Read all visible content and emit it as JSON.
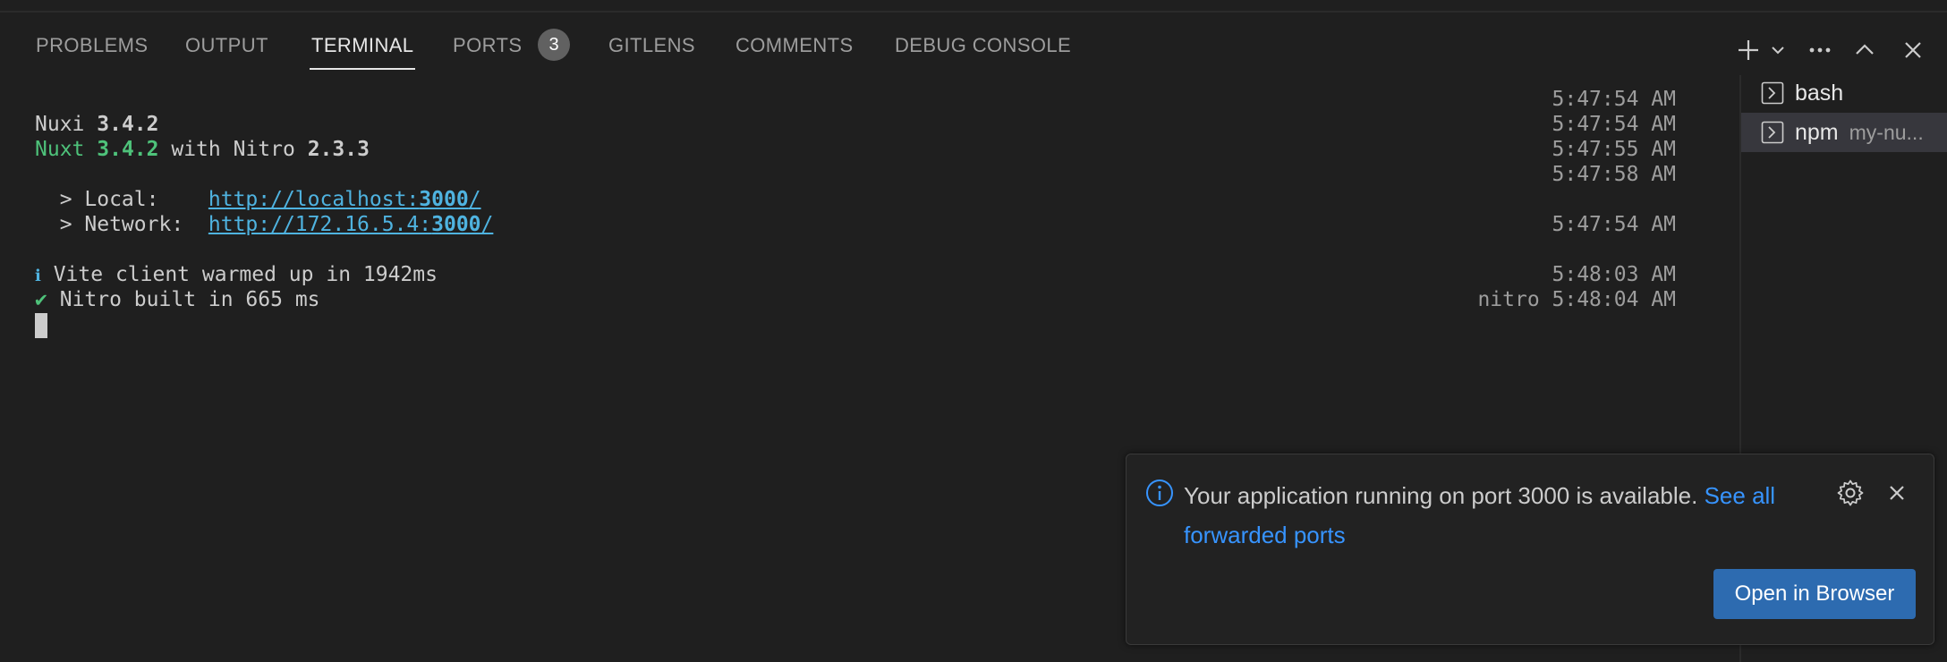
{
  "panel": {
    "tabs": [
      {
        "label": "PROBLEMS"
      },
      {
        "label": "OUTPUT"
      },
      {
        "label": "TERMINAL"
      },
      {
        "label": "PORTS"
      },
      {
        "label": "GITLENS"
      },
      {
        "label": "COMMENTS"
      },
      {
        "label": "DEBUG CONSOLE"
      }
    ],
    "active_tab": "TERMINAL",
    "ports_badge": "3",
    "actions": [
      "plus-icon",
      "chevron-down-icon",
      "ellipsis-icon",
      "chevron-up-icon",
      "close-icon"
    ]
  },
  "terminal": {
    "lines": {
      "nuxi_label": "Nuxi",
      "nuxi_version": "3.4.2",
      "nuxt_label": "Nuxt",
      "nuxt_version": "3.4.2",
      "with_nitro": "with Nitro",
      "nitro_version": "2.3.3",
      "local_label": "  > Local:    ",
      "local_url_base": "http://localhost:",
      "local_url_port": "3000",
      "local_url_tail": "/",
      "network_label": "  > Network:  ",
      "network_url_base": "http://172.16.5.4:",
      "network_url_port": "3000",
      "network_url_tail": "/",
      "info_symbol": "ℹ",
      "vite_text": "Vite client warmed up in 1942ms",
      "check_symbol": "✔",
      "nitro_text": "Nitro built in 665 ms"
    },
    "timestamps": {
      "t1": "5:47:54 AM",
      "t2": "5:47:54 AM",
      "t3": "5:47:55 AM",
      "t4": "5:47:58 AM",
      "t5": "5:47:54 AM",
      "t6": "5:48:03 AM",
      "t7": "nitro 5:48:04 AM"
    }
  },
  "terminal_list": [
    {
      "name": "bash",
      "desc": ""
    },
    {
      "name": "npm",
      "desc": "my-nu..."
    }
  ],
  "notification": {
    "message": "Your application running on port 3000 is available.",
    "link_label_1": "See all",
    "link_label_2": "forwarded ports",
    "button_label": "Open in Browser",
    "icons": [
      "info-icon",
      "gear-icon",
      "close-icon"
    ]
  },
  "colors": {
    "background": "#1f1f1f",
    "green": "#4ec27a",
    "link": "#4fb3e0",
    "accent_button": "#2d6bb0",
    "notification_link": "#3794ff"
  }
}
